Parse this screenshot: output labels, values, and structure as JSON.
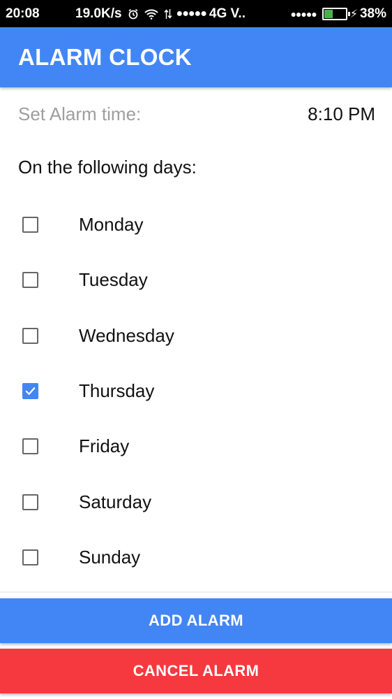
{
  "status_bar": {
    "time": "20:08",
    "speed": "19.0K/s",
    "alarm_icon": "alarm-icon",
    "wifi_icon": "wifi-icon",
    "data_icon": "data-arrows-icon",
    "signal_dots": "●●●●●",
    "carrier": "4G V..",
    "signal_dots2": "●●●●●",
    "battery_icon": "battery-icon",
    "battery_level": 0.38,
    "charging_icon": "charging-bolt-icon",
    "battery_percent": "38%"
  },
  "app_bar": {
    "title": "ALARM CLOCK",
    "color": "#4286f5"
  },
  "alarm": {
    "time_label": "Set Alarm time:",
    "time_value": "8:10 PM",
    "days_label": "On the following days:"
  },
  "days": [
    {
      "label": "Monday",
      "checked": false
    },
    {
      "label": "Tuesday",
      "checked": false
    },
    {
      "label": "Wednesday",
      "checked": false
    },
    {
      "label": "Thursday",
      "checked": true
    },
    {
      "label": "Friday",
      "checked": false
    },
    {
      "label": "Saturday",
      "checked": false
    },
    {
      "label": "Sunday",
      "checked": false
    }
  ],
  "buttons": {
    "add_label": "ADD ALARM",
    "add_color": "#4286f5",
    "cancel_label": "CANCEL ALARM",
    "cancel_color": "#f5393e"
  }
}
